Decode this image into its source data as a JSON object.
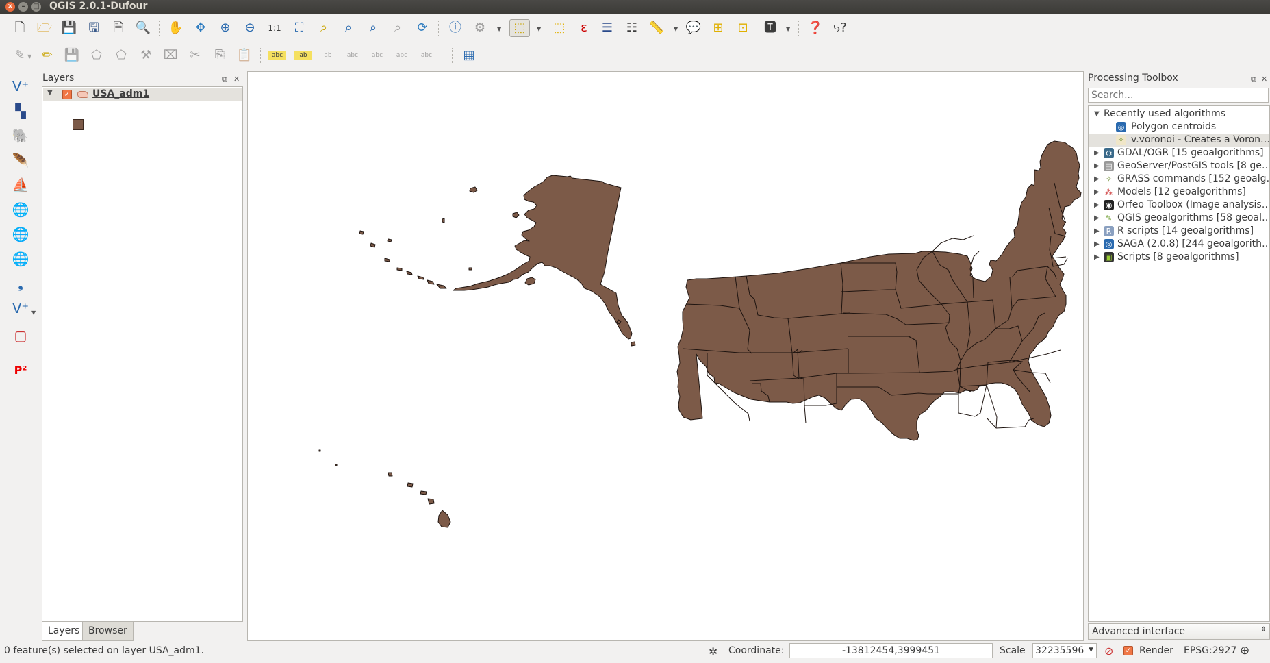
{
  "window": {
    "title": "QGIS 2.0.1-Dufour"
  },
  "toolbar_main": [
    "new-project-icon",
    "open-project-icon",
    "save-project-icon",
    "save-as-icon",
    "new-print-composer-icon",
    "composer-manager-icon",
    "pan-icon",
    "pan-to-selection-icon",
    "zoom-in-icon",
    "zoom-out-icon",
    "zoom-actual-icon",
    "zoom-full-icon",
    "zoom-to-layer-icon",
    "zoom-to-selection-icon",
    "zoom-last-icon",
    "zoom-next-icon",
    "refresh-icon",
    "identify-icon",
    "run-feature-action-icon",
    "select-features-icon",
    "deselect-icon",
    "field-calculator-icon",
    "attribute-table-icon",
    "statistical-summary-icon",
    "measure-line-icon",
    "map-tips-icon",
    "new-bookmark-icon",
    "show-bookmarks-icon",
    "text-annotation-icon",
    "help-contents-icon",
    "whats-this-icon"
  ],
  "toolbar_edit": [
    "current-edits-icon",
    "toggle-editing-icon",
    "save-layer-edits-icon",
    "add-feature-icon",
    "move-feature-icon",
    "node-tool-icon",
    "delete-selected-icon",
    "cut-features-icon",
    "copy-features-icon",
    "paste-features-icon",
    "label-tool-icon",
    "pin-labels-icon",
    "show-hide-labels-icon",
    "move-label-icon",
    "rotate-label-icon",
    "change-label-icon",
    "label-settings-icon",
    "ogc-plugin-icon"
  ],
  "left_toolbar": [
    "add-vector-layer-icon",
    "add-raster-layer-icon",
    "add-postgis-layer-icon",
    "add-spatialite-layer-icon",
    "add-mssql-layer-icon",
    "add-wms-layer-icon",
    "add-wcs-layer-icon",
    "add-wfs-layer-icon",
    "add-delimited-text-icon",
    "add-oracle-layer-icon",
    "new-shapefile-icon",
    "p2-plugin-icon"
  ],
  "left_toolbar_p2_text": "P²",
  "layers_panel": {
    "title": "Layers",
    "layer_name": "USA_adm1",
    "layer_fill_color": "#7c5a48",
    "tabs": [
      "Layers",
      "Browser"
    ]
  },
  "map": {
    "fill": "#7c5a48",
    "stroke": "#1e1410",
    "background": "#ffffff"
  },
  "processing": {
    "title": "Processing Toolbox",
    "search_placeholder": "Search...",
    "recent_group": "Recently used algorithms",
    "recent_items": [
      "Polygon centroids",
      "v.voronoi - Creates a Voron…"
    ],
    "providers": [
      "GDAL/OGR [15 geoalgorithms]",
      "GeoServer/PostGIS tools [8 ge…",
      "GRASS commands [152 geoalg…",
      "Models [12 geoalgorithms]",
      "Orfeo Toolbox (Image analysis…",
      "QGIS geoalgorithms [58 geoal…",
      "R scripts [14 geoalgorithms]",
      "SAGA (2.0.8) [244 geoalgorith…",
      "Scripts [8 geoalgorithms]"
    ],
    "interface_mode": "Advanced interface"
  },
  "statusbar": {
    "message": "0 feature(s) selected on layer USA_adm1.",
    "coordinate_label": "Coordinate:",
    "coordinate_value": "-13812454,3999451",
    "scale_label": "Scale",
    "scale_value": "32235596",
    "render_label": "Render",
    "crs_label": "EPSG:2927"
  }
}
